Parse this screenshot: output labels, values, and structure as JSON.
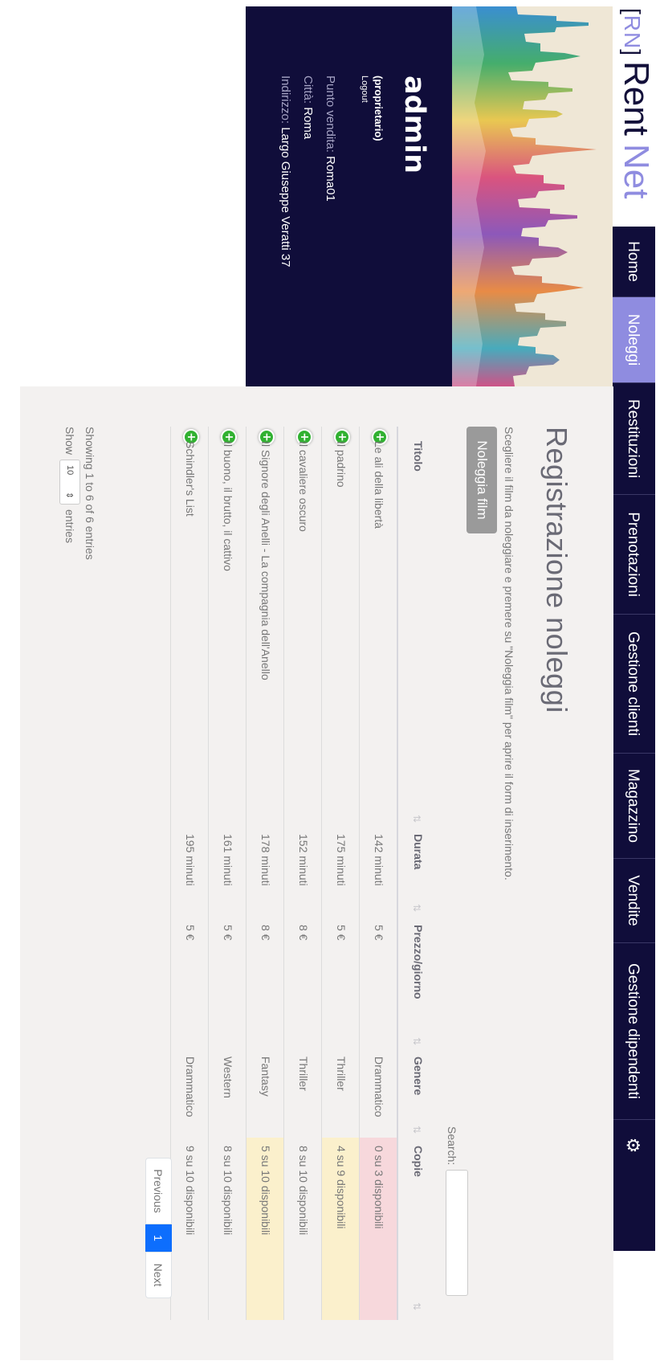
{
  "logo": {
    "bracket_left": "[",
    "bracket_letters": "RN",
    "bracket_right": "]",
    "word1": "Rent",
    "word2": "Net"
  },
  "nav": {
    "items": [
      {
        "label": "Home"
      },
      {
        "label": "Noleggi",
        "active": true
      },
      {
        "label": "Restituzioni"
      },
      {
        "label": "Prenotazioni"
      },
      {
        "label": "Gestione clienti"
      },
      {
        "label": "Magazzino"
      },
      {
        "label": "Vendite"
      },
      {
        "label": "Gestione dipendenti"
      }
    ],
    "settings_icon": "⚙",
    "icon_name": "gear-icon"
  },
  "user": {
    "name": "admin",
    "role": "(proprietario)",
    "logout": "Logout",
    "store_label": "Punto vendita:",
    "store_value": "Roma01",
    "city_label": "Città:",
    "city_value": "Roma",
    "address_label": "Indirizzo:",
    "address_value": "Largo Giuseppe Veratti 37"
  },
  "page": {
    "title": "Registrazione noleggi",
    "subtitle": "Scegliere il film da noleggiare e premere su \"Noleggia film\" per aprire il form di inserimento.",
    "rent_button": "Noleggia film",
    "search_label": "Search:",
    "search_value": ""
  },
  "table": {
    "headers": {
      "title": "Titolo",
      "duration": "Durata",
      "price": "Prezzo/giorno",
      "genre": "Genere",
      "copies": "Copie"
    },
    "sort_icon": "⇅",
    "add_icon": "+",
    "rows": [
      {
        "title": "Le ali della libertà",
        "duration": "142 minuti",
        "price": "5 €",
        "genre": "Drammatico",
        "copies": "0 su 3 disponibili",
        "status": "danger"
      },
      {
        "title": "Il padrino",
        "duration": "175 minuti",
        "price": "5 €",
        "genre": "Thriller",
        "copies": "4 su 9 disponibili",
        "status": "warning"
      },
      {
        "title": "Il cavaliere oscuro",
        "duration": "152 minuti",
        "price": "8 €",
        "genre": "Thriller",
        "copies": "8 su 10 disponibili",
        "status": ""
      },
      {
        "title": "Il Signore degli Anelli - La compagnia dell'Anello",
        "duration": "178 minuti",
        "price": "8 €",
        "genre": "Fantasy",
        "copies": "5 su 10 disponibili",
        "status": "warning"
      },
      {
        "title": "Il buono, il brutto, il cattivo",
        "duration": "161 minuti",
        "price": "5 €",
        "genre": "Western",
        "copies": "8 su 10 disponibili",
        "status": ""
      },
      {
        "title": "Schindler's List",
        "duration": "195 minuti",
        "price": "5 €",
        "genre": "Drammatico",
        "copies": "9 su 10 disponibili",
        "status": ""
      }
    ]
  },
  "footer": {
    "info": "Showing 1 to 6 of 6 entries",
    "show": "Show",
    "length_value": "10",
    "entries": "entries",
    "pagination": {
      "previous": "Previous",
      "current": "1",
      "next": "Next"
    }
  },
  "colors": {
    "nav_bg": "#100d3a",
    "accent": "#8f8ce0",
    "row_danger": "#f7d8dc",
    "row_warning": "#fbf0cc",
    "add_icon": "#31b131",
    "page_current": "#0d6efd"
  }
}
